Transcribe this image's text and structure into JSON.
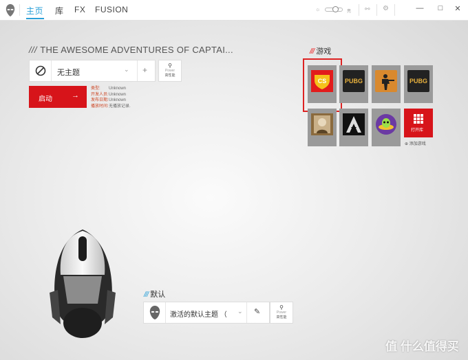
{
  "nav": {
    "home": "主页",
    "library": "库",
    "fx": "FX",
    "fusion": "FUSION"
  },
  "topbar": {
    "brightness_label": "亮",
    "icon_adjust": "sliders-icon",
    "icon_settings": "gear-icon",
    "minimize": "—",
    "maximize": "□",
    "close": "✕"
  },
  "theme": {
    "slashes": "///",
    "title": "THE AWESOME ADVENTURES OF CAPTAI...",
    "theme_name": "无主题",
    "add": "+",
    "power_line1": "Power",
    "power_line2": "高性能",
    "launch": "启动",
    "info": [
      {
        "key": "类型:",
        "value": "Unknown"
      },
      {
        "key": "开发人员:",
        "value": "Unknown"
      },
      {
        "key": "发布日期:",
        "value": "Unknown"
      },
      {
        "key": "播放时间:",
        "value": "无播放记录."
      }
    ]
  },
  "games": {
    "slashes": "///",
    "title": "游戏",
    "tiles": [
      "CS",
      "PUBG",
      "Counter-Strike",
      "PUBG",
      "Portrait",
      "Assassin's Creed",
      "Alien",
      "打开库"
    ],
    "open_library": "打开库",
    "add_game": "添加游戏"
  },
  "default_section": {
    "slashes": "///",
    "title": "默认",
    "theme_name": "激活的默认主题 （",
    "power_line1": "Power",
    "power_line2": "高性能"
  },
  "watermark": "值 什么值得买",
  "colors": {
    "accent": "#2aa0d8",
    "red": "#d7141a"
  }
}
